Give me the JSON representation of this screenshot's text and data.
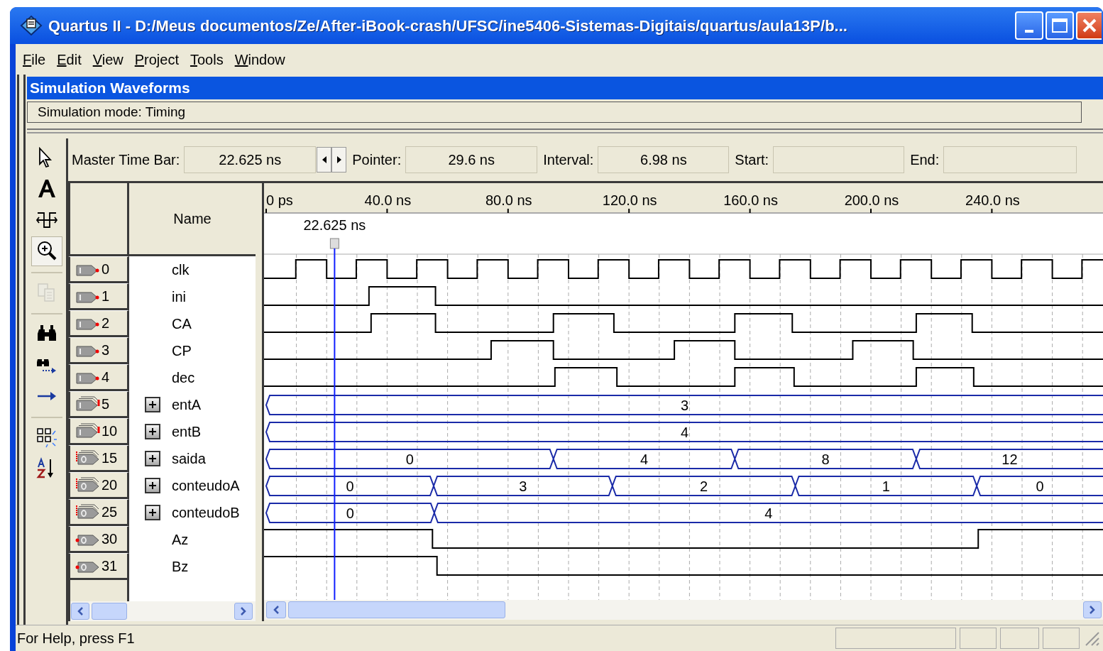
{
  "window": {
    "title": "Quartus II - D:/Meus documentos/Ze/After-iBook-crash/UFSC/ine5406-Sistemas-Digitais/quartus/aula13P/b..."
  },
  "menu": [
    "File",
    "Edit",
    "View",
    "Project",
    "Tools",
    "Window"
  ],
  "document": {
    "title": "Simulation Waveforms",
    "mode": "Simulation mode: Timing"
  },
  "tools": [
    {
      "kind": "select",
      "selected": false,
      "disabled": false
    },
    {
      "kind": "text",
      "selected": false,
      "disabled": false
    },
    {
      "kind": "waveform-edit",
      "selected": false,
      "disabled": false
    },
    {
      "kind": "zoom",
      "selected": true,
      "disabled": false
    },
    {
      "kind": "copy",
      "selected": false,
      "disabled": true
    },
    {
      "kind": "find",
      "selected": false,
      "disabled": false
    },
    {
      "kind": "find-next",
      "selected": false,
      "disabled": false
    },
    {
      "kind": "goto",
      "selected": false,
      "disabled": false
    },
    {
      "kind": "group",
      "selected": false,
      "disabled": false
    },
    {
      "kind": "sort",
      "selected": false,
      "disabled": false
    }
  ],
  "time_bar": {
    "fields": [
      {
        "label": "Master Time Bar:",
        "value": "22.625 ns"
      },
      {
        "label": "Pointer:",
        "value": "29.6 ns"
      },
      {
        "label": "Interval:",
        "value": "6.98 ns"
      },
      {
        "label": "Start:"
      },
      {
        "label": "End:"
      }
    ]
  },
  "waveform": {
    "name_header": "Name",
    "ruler": [
      "0 ps",
      "40.0 ns",
      "80.0 ns",
      "120.0 ns",
      "160.0 ns",
      "200.0 ns",
      "240.0 ns"
    ],
    "master_marker": "22.625 ns",
    "signals": [
      {
        "index": "0",
        "name": "clk",
        "kind": "input"
      },
      {
        "index": "1",
        "name": "ini",
        "kind": "input"
      },
      {
        "index": "2",
        "name": "CA",
        "kind": "input"
      },
      {
        "index": "3",
        "name": "CP",
        "kind": "input"
      },
      {
        "index": "4",
        "name": "dec",
        "kind": "input"
      },
      {
        "index": "5",
        "name": "entA",
        "kind": "input-bus",
        "expanded": false,
        "values": [
          "3"
        ]
      },
      {
        "index": "10",
        "name": "entB",
        "kind": "input-bus",
        "expanded": false,
        "values": [
          "4"
        ]
      },
      {
        "index": "15",
        "name": "saida",
        "kind": "output-bus",
        "expanded": false,
        "values": [
          "0",
          "4",
          "8",
          "12"
        ]
      },
      {
        "index": "20",
        "name": "conteudoA",
        "kind": "output-bus",
        "expanded": false,
        "values": [
          "0",
          "3",
          "2",
          "1",
          "0"
        ]
      },
      {
        "index": "25",
        "name": "conteudoB",
        "kind": "output-bus",
        "expanded": false,
        "values": [
          "0",
          "4"
        ]
      },
      {
        "index": "30",
        "name": "Az",
        "kind": "output"
      },
      {
        "index": "31",
        "name": "Bz",
        "kind": "output"
      }
    ]
  },
  "status_bar": {
    "text": "For Help, press F1"
  }
}
